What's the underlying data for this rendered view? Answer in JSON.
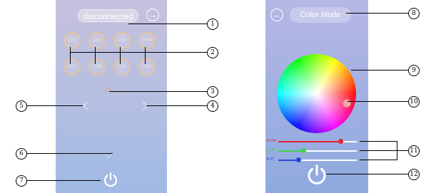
{
  "left_panel": {
    "connection_status": "disconnected",
    "channels": [
      "CH1",
      "CH2",
      "CH3",
      "CH4",
      "CH5",
      "CH6",
      "CH7",
      "CH8"
    ]
  },
  "right_panel": {
    "mode_title": "Color Mode",
    "sliders": [
      {
        "label": "R:255",
        "color": "#e8232a",
        "value": 0.79
      },
      {
        "label": "G:38",
        "color": "#3fd24a",
        "value": 0.32
      },
      {
        "label": "B:27",
        "color": "#2546d8",
        "value": 0.25
      }
    ]
  },
  "callouts": [
    "1",
    "2",
    "3",
    "4",
    "5",
    "6",
    "7",
    "8",
    "9",
    "10",
    "11",
    "12"
  ],
  "colors": {
    "left_bg": "#b4bfe1",
    "right_bg": "#9fb0e2",
    "channel_ring": "#e5c49a"
  }
}
